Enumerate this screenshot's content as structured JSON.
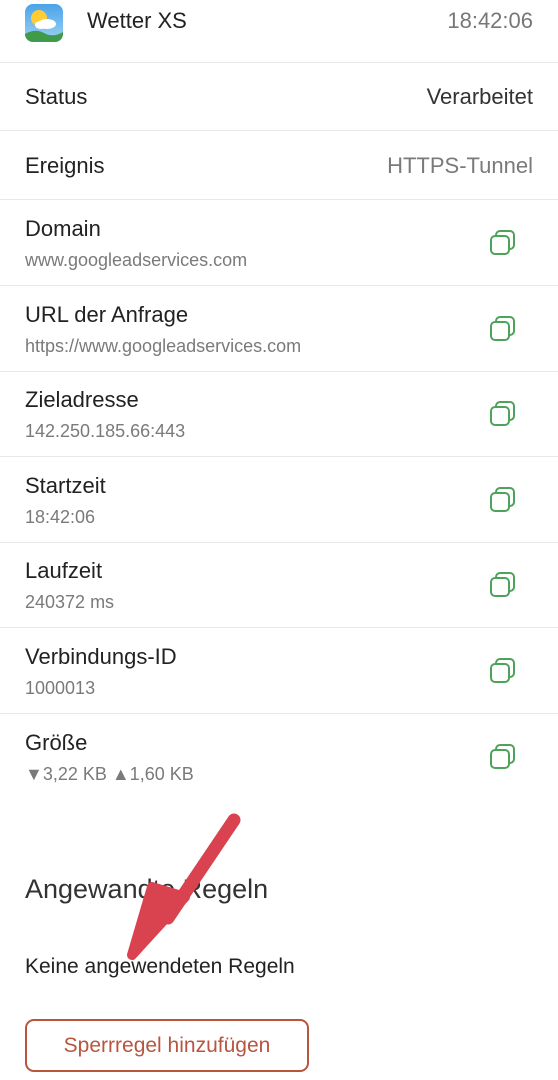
{
  "header": {
    "app_name": "Wetter XS",
    "time": "18:42:06",
    "icon": "weather-app-icon"
  },
  "status_row": {
    "label": "Status",
    "value": "Verarbeitet",
    "value_color": "#333333"
  },
  "event_row": {
    "label": "Ereignis",
    "value": "HTTPS-Tunnel",
    "value_color": "#7a7a7a"
  },
  "details": [
    {
      "label": "Domain",
      "value": "www.googleadservices.com"
    },
    {
      "label": "URL der Anfrage",
      "value": "https://www.googleadservices.com"
    },
    {
      "label": "Zieladresse",
      "value": "142.250.185.66:443"
    },
    {
      "label": "Startzeit",
      "value": "18:42:06"
    },
    {
      "label": "Laufzeit",
      "value": "240372 ms"
    },
    {
      "label": "Verbindungs-ID",
      "value": "1000013"
    },
    {
      "label": "Größe",
      "value": "▼3,22 KB ▲1,60 KB"
    }
  ],
  "copy_icon": "copy-icon",
  "copy_icon_color": "#4ea35a",
  "rules": {
    "title": "Angewandte Regeln",
    "empty_text": "Keine angewendeten Regeln",
    "add_block_rule_label": "Sperrregel hinzufügen",
    "accent_color": "#b8553f"
  },
  "annotation": {
    "arrow_color": "#d94350",
    "icon": "red-arrow-annotation"
  }
}
